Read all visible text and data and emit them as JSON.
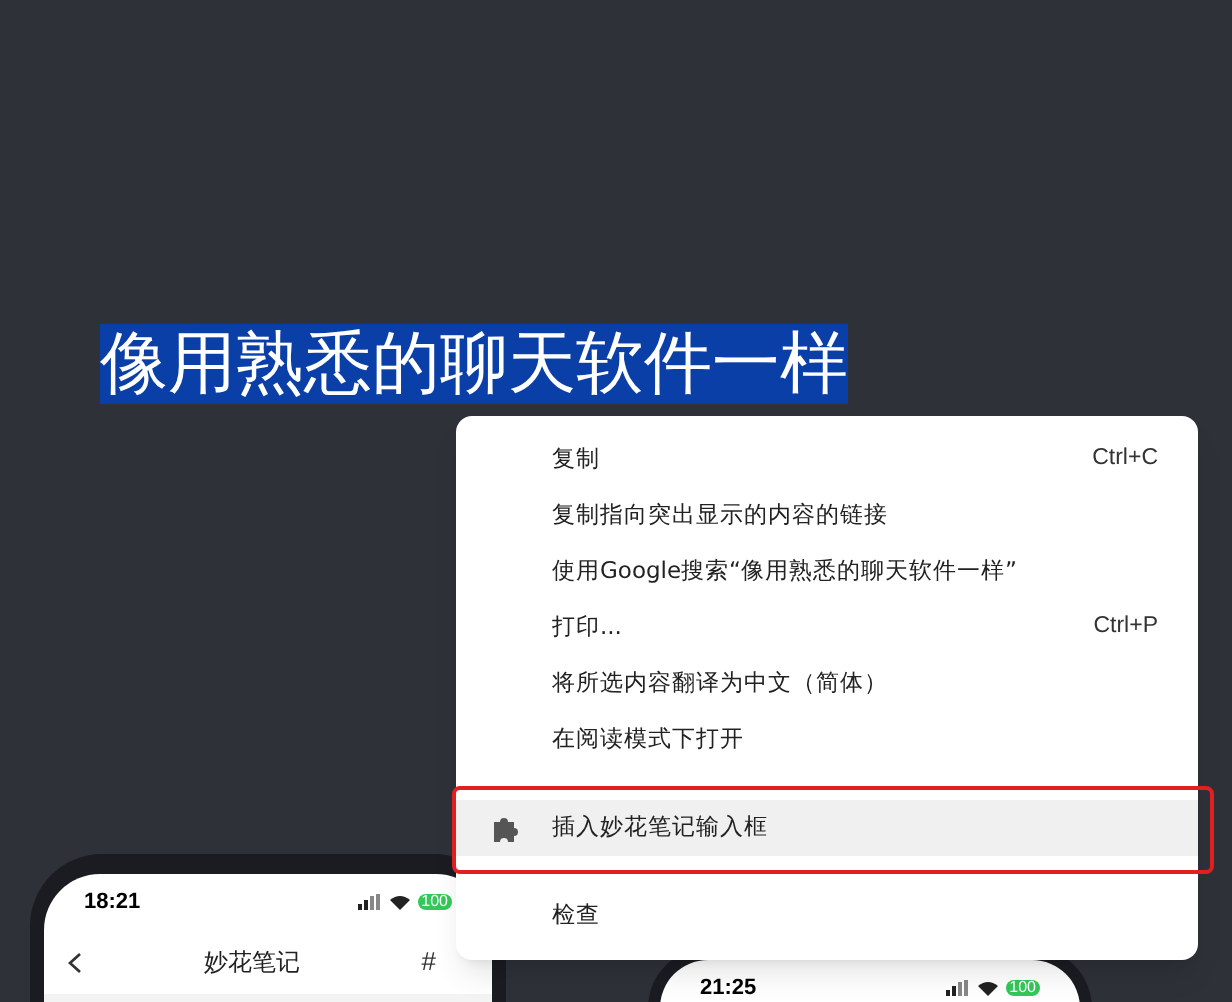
{
  "heading": {
    "text": "像用熟悉的聊天软件一样",
    "selected": true
  },
  "phones": [
    {
      "time": "18:21",
      "battery": "100",
      "title": "妙花笔记",
      "action": "#"
    },
    {
      "time": "21:25",
      "battery": "100"
    }
  ],
  "context_menu": {
    "items": [
      {
        "kind": "item",
        "label": "复制",
        "shortcut": "Ctrl+C",
        "highlighted": false,
        "outlined": false
      },
      {
        "kind": "item",
        "label": "复制指向突出显示的内容的链接",
        "highlighted": false,
        "outlined": false
      },
      {
        "kind": "item",
        "label": "使用Google搜索“像用熟悉的聊天软件一样”",
        "highlighted": false,
        "outlined": false
      },
      {
        "kind": "item",
        "label": "打印...",
        "shortcut": "Ctrl+P",
        "highlighted": false,
        "outlined": false
      },
      {
        "kind": "item",
        "label": "将所选内容翻译为中文（简体）",
        "highlighted": false,
        "outlined": false
      },
      {
        "kind": "item",
        "label": "在阅读模式下打开",
        "highlighted": false,
        "outlined": false
      },
      {
        "kind": "separator"
      },
      {
        "kind": "extension",
        "label": "插入妙花笔记输入框",
        "highlighted": true,
        "outlined": true
      },
      {
        "kind": "separator"
      },
      {
        "kind": "item",
        "label": "检查",
        "highlighted": false,
        "outlined": false
      }
    ]
  }
}
